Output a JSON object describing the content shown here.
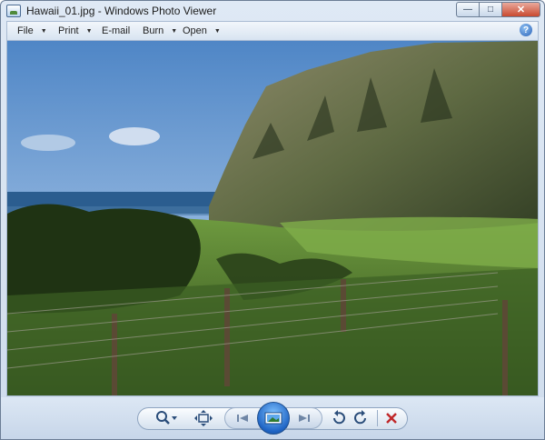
{
  "window": {
    "title": "Hawaii_01.jpg - Windows Photo Viewer"
  },
  "caption_buttons": {
    "minimize": "—",
    "maximize": "□",
    "close": "✕"
  },
  "menu": [
    {
      "label": "File",
      "has_dropdown": true
    },
    {
      "label": "Print",
      "has_dropdown": true
    },
    {
      "label": "E-mail",
      "has_dropdown": false
    },
    {
      "label": "Burn",
      "has_dropdown": true
    },
    {
      "label": "Open",
      "has_dropdown": true
    }
  ],
  "help": {
    "label": "?"
  },
  "photo": {
    "description_icon": "landscape-photo"
  },
  "toolbar": {
    "zoom_icon": "zoom-icon",
    "fit_icon": "actual-size-icon",
    "prev_icon": "previous-icon",
    "slideshow_icon": "slideshow-icon",
    "next_icon": "next-icon",
    "rotate_left_icon": "rotate-counterclockwise-icon",
    "rotate_right_icon": "rotate-clockwise-icon",
    "delete_icon": "delete-icon"
  },
  "colors": {
    "accent": "#1f64c4",
    "delete": "#c0282a",
    "frame": "#cfdcec"
  }
}
